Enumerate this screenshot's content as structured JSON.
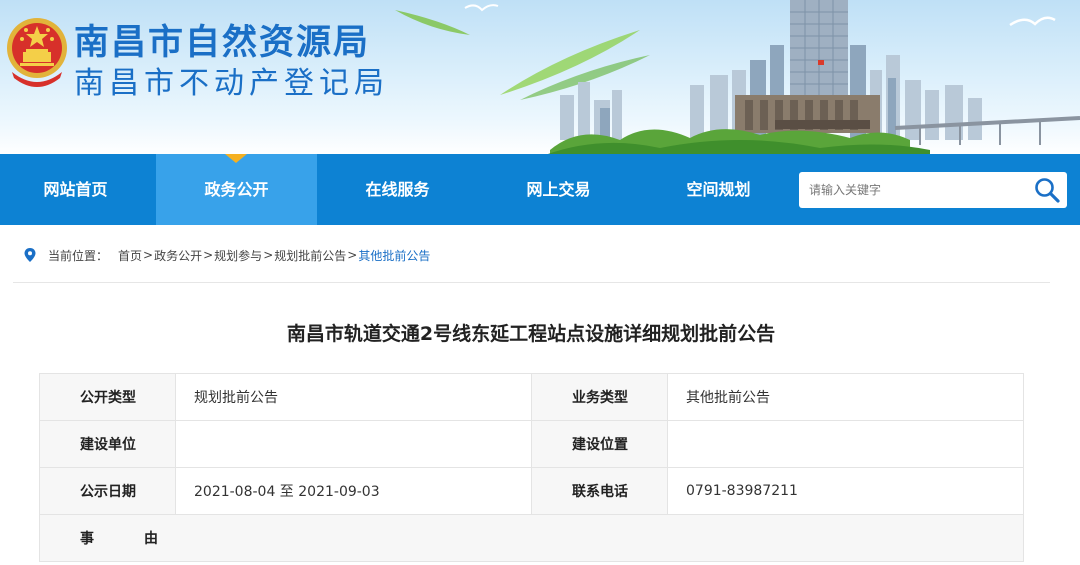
{
  "header": {
    "title_main": "南昌市自然资源局",
    "title_sub": "南昌市不动产登记局"
  },
  "nav": {
    "items": [
      {
        "label": "网站首页",
        "active": false
      },
      {
        "label": "政务公开",
        "active": true
      },
      {
        "label": "在线服务",
        "active": false
      },
      {
        "label": "网上交易",
        "active": false
      },
      {
        "label": "空间规划",
        "active": false
      }
    ],
    "search_placeholder": "请输入关键字",
    "colors": {
      "nav_bg": "#0d82d3",
      "active_bg": "#38a2ea",
      "caret": "#f5b021"
    }
  },
  "breadcrumb": {
    "label": "当前位置：",
    "items": [
      "首页",
      "政务公开",
      "规划参与",
      "规划批前公告"
    ],
    "separator": ">",
    "current": "其他批前公告"
  },
  "article": {
    "title": "南昌市轨道交通2号线东延工程站点设施详细规划批前公告",
    "fields": {
      "public_type_label": "公开类型",
      "public_type_value": "规划批前公告",
      "business_type_label": "业务类型",
      "business_type_value": "其他批前公告",
      "construction_unit_label": "建设单位",
      "construction_unit_value": "",
      "construction_location_label": "建设位置",
      "construction_location_value": "",
      "notice_date_label": "公示日期",
      "notice_date_value": "2021-08-04 至 2021-09-03",
      "phone_label": "联系电话",
      "phone_value": "0791-83987211",
      "reason_label": "事　由"
    }
  }
}
